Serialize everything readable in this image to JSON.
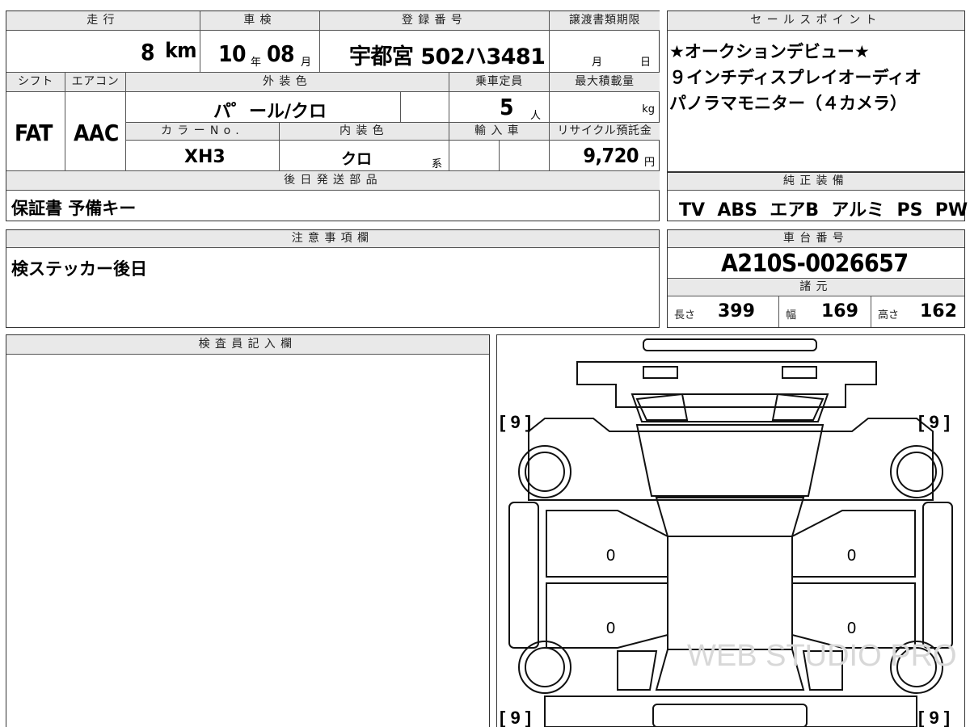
{
  "vehicle": {
    "headers": {
      "mileage": "走行",
      "inspection": "車検",
      "registration": "登録番号",
      "transfer_deadline": "譲渡書類期限",
      "shift": "シフト",
      "ac": "エアコン",
      "exterior_color": "外装色",
      "capacity": "乗車定員",
      "max_load": "最大積載量",
      "color_no": "カラーNo.",
      "interior_color": "内装色",
      "import": "輸入車",
      "recycle": "リサイクル預託金",
      "later_parts": "後日発送部品"
    },
    "mileage_value": "8",
    "mileage_unit": "km",
    "inspection_year": "10",
    "inspection_year_unit": "年",
    "inspection_month": "08",
    "inspection_month_unit": "月",
    "registration_number": "宇都宮 502ハ3481",
    "transfer_month_unit": "月",
    "transfer_day_unit": "日",
    "shift": "FAT",
    "ac": "AAC",
    "exterior_color": "パ゜ール/クロ",
    "capacity_value": "5",
    "capacity_unit": "人",
    "load_unit": "kg",
    "color_no": "XH3",
    "interior_color": "クロ",
    "interior_suffix": "系",
    "recycle_value": "9,720",
    "recycle_unit": "円",
    "later_parts": "保証書 予備キー"
  },
  "sales_point": {
    "header": "セールスポイント",
    "lines": [
      "★オークションデビュー★",
      "９インチディスプレイオーディオ",
      "パノラマモニター（４カメラ）"
    ]
  },
  "equipment": {
    "header": "純正装備",
    "items": "TV  ABS  エアB  アルミ  PS  PW"
  },
  "notes": {
    "header": "注意事項欄",
    "text": "検ステッカー後日"
  },
  "chassis": {
    "header": "車台番号",
    "number": "A210S-0026657"
  },
  "specs": {
    "header": "諸元",
    "length_label": "長さ",
    "length": "399",
    "width_label": "幅",
    "width": "169",
    "height_label": "高さ",
    "height": "162"
  },
  "inspector": {
    "header": "検査員記入欄"
  },
  "diagram": {
    "tire_fl": "[ 9 ]",
    "tire_fr": "[ 9 ]",
    "tire_rl": "[ 9 ]",
    "tire_rr": "[ 9 ]",
    "door_fl": "0",
    "door_fr": "0",
    "door_rl": "0",
    "door_rr": "0",
    "watermark": "WEB STUDIO PRO"
  }
}
